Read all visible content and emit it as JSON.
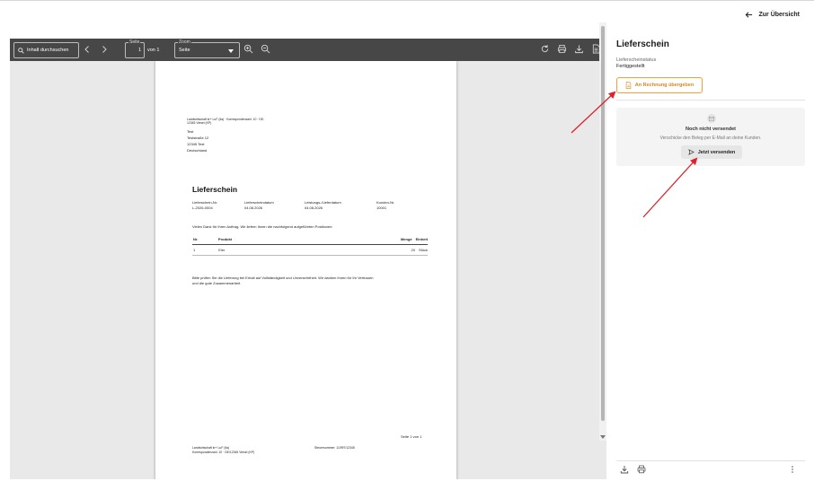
{
  "header": {
    "back_label": "Zur Übersicht"
  },
  "viewer": {
    "search_placeholder": "Inhalt durchsuchen",
    "page_legend": "Seite",
    "page_value": "1",
    "page_total": "von 1",
    "zoom_legend": "Zoom",
    "zoom_value": "Seite"
  },
  "document": {
    "sender_line_1": "Landwirtschaft kr+ LuF (Ila) · Korrespondenzanl. 10 · DE-",
    "sender_line_2": "12345 Viesel (KP)",
    "recipient": [
      "Test",
      "Teststraße 12",
      "12345 Test",
      "Deutschland"
    ],
    "title": "Lieferschein",
    "meta": [
      {
        "label": "Lieferschein-Nr.",
        "value": "L-2026-0004"
      },
      {
        "label": "Lieferscheindatum",
        "value": "04.08.2026"
      },
      {
        "label": "Leistungs-/Lieferdatum",
        "value": "04.08.2026"
      },
      {
        "label": "Kunden-Nr.",
        "value": "10001"
      }
    ],
    "intro": "Vielen Dank für Ihren Auftrag. Wir liefern Ihnen die nachfolgend aufgeführten Positionen:",
    "table_headers": [
      "Nr.",
      "Produkt",
      "Menge",
      "Einheit"
    ],
    "table_rows": [
      {
        "nr": "1",
        "produkt": "Eier",
        "menge": "20",
        "einheit": "Stück"
      }
    ],
    "closing_1": "Bitte prüfen Sie die Lieferung bei Erhalt auf Vollständigkeit und Unversehrtheit. Wir danken Ihnen für Ihr Vertrauen",
    "closing_2": "und die gute Zusammenarbeit.",
    "page_footer": "Seite 1 von 1",
    "footer_left_1": "Landwirtschaft kr+ LuF (Ila)",
    "footer_left_2": "Korrespondenzanl. 10 · DE/12345 Viesel (KP)",
    "footer_right": "Steuernummer: 11/997/12345"
  },
  "panel": {
    "title": "Lieferschein",
    "status_label": "Lieferscheinstatus",
    "status_value": "Fertiggestellt",
    "invoice_button": "An Rechnung übergeben",
    "send_title": "Noch nicht versendet",
    "send_subtitle": "Verschicke den Beleg per E-Mail an deine Kunden.",
    "send_button": "Jetzt versenden"
  },
  "colors": {
    "accent": "#e5831b",
    "annotation": "#e0202a",
    "toolbar": "#474747"
  },
  "icons": [
    "arrow-left-icon",
    "search-icon",
    "chevron-left-icon",
    "chevron-right-icon",
    "zoom-in-icon",
    "zoom-out-icon",
    "rotate-icon",
    "print-icon",
    "download-icon",
    "document-icon",
    "file-pdf-icon",
    "mail-icon",
    "send-icon",
    "more-icon"
  ]
}
